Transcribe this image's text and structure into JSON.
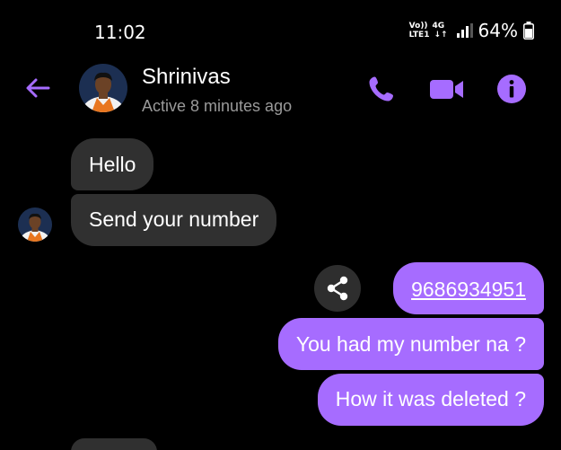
{
  "status_bar": {
    "time": "11:02",
    "net_line1_a": "Vo))",
    "net_line1_b": "4G",
    "net_line2_a": "LTE1",
    "net_line2_b": "↓↑",
    "battery": "64%"
  },
  "header": {
    "contact_name": "Shrinivas",
    "contact_status": "Active 8 minutes ago"
  },
  "messages": [
    {
      "direction": "incoming",
      "text": "Hello"
    },
    {
      "direction": "incoming",
      "text": "Send your number"
    },
    {
      "direction": "outgoing",
      "text": "9686934951"
    },
    {
      "direction": "outgoing",
      "text": "You had my number na ?"
    },
    {
      "direction": "outgoing",
      "text": "How it was deleted ?"
    }
  ],
  "icons": {
    "back": "back-arrow-icon",
    "call": "phone-icon",
    "video": "video-camera-icon",
    "info": "info-icon",
    "share": "share-icon"
  },
  "colors": {
    "accent": "#a66cff",
    "background": "#000000",
    "incoming_bubble": "#303030",
    "outgoing_bubble": "#a66cff",
    "secondary_text": "#9a9a9a"
  }
}
